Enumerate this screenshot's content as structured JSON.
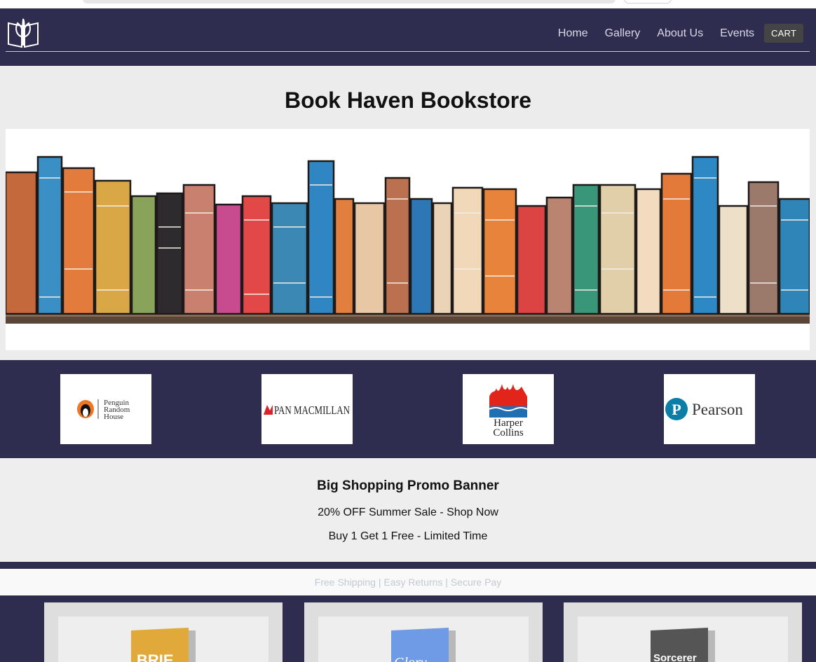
{
  "nav": {
    "logo_icon": "open-book-leaf-icon",
    "links": [
      "Home",
      "Gallery",
      "About Us",
      "Events"
    ],
    "cart_label": "CART"
  },
  "hero": {
    "title": "Book Haven Bookstore",
    "image": "bookshelf-illustration"
  },
  "publishers": {
    "penguin_text": [
      "Penguin",
      "Random",
      "House"
    ],
    "macmillan_text": "PAN MACMILLAN",
    "harper_text": [
      "Harper",
      "Collins"
    ],
    "pearson_text": "Pearson"
  },
  "promo": {
    "title": "Big Shopping Promo Banner",
    "line1": "20% OFF Summer Sale - Shop Now",
    "line2": "Buy 1 Get 1 Free - Limited Time"
  },
  "infostrip": {
    "text": "Free Shipping | Easy Returns | Secure Pay"
  },
  "products": [
    {
      "cover_text": "BRIE",
      "cover_color": "#e0a93a"
    },
    {
      "cover_text": "Glory",
      "cover_color": "#6f9be6"
    },
    {
      "cover_text": "Sorcerer",
      "cover_color": "#555555"
    }
  ],
  "colors": {
    "navy": "#2e2d4f",
    "light_bg": "#ececec",
    "cart_bg": "#444444"
  }
}
